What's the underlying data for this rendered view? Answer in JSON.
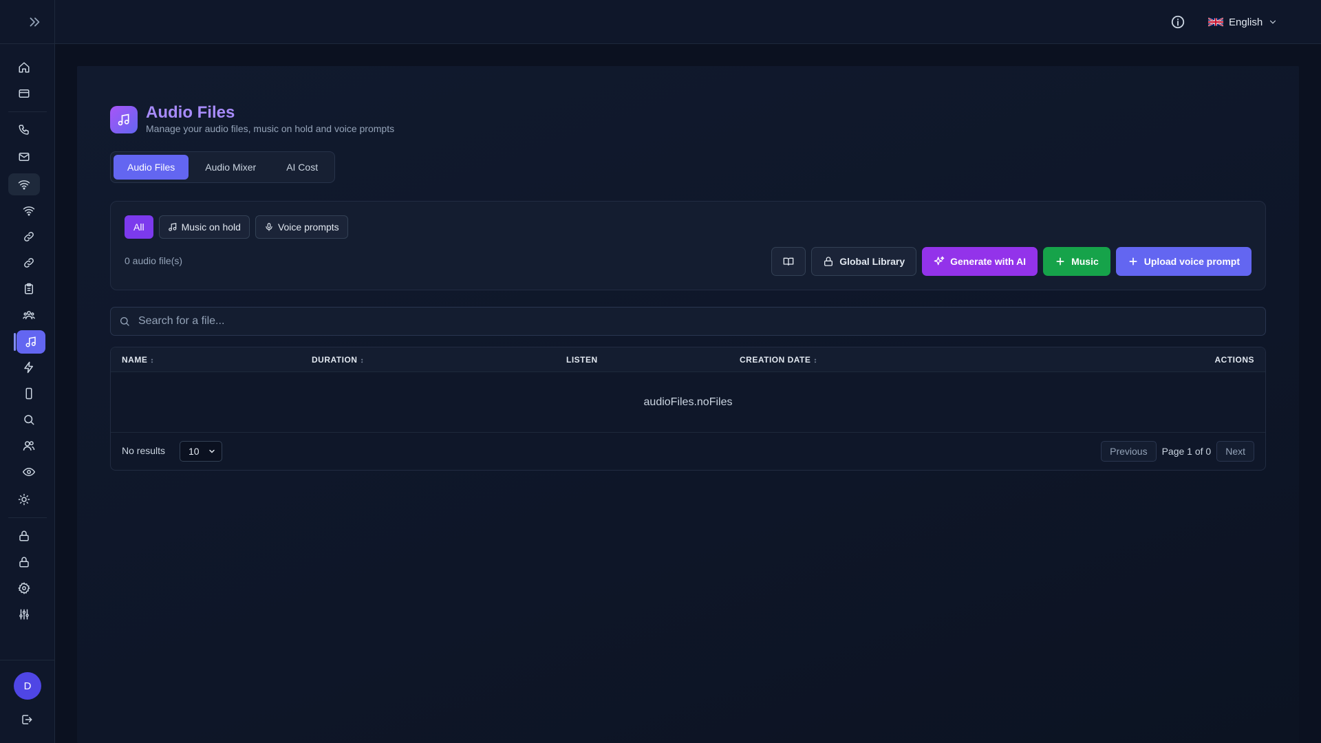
{
  "topbar": {
    "language": "English",
    "info_icon": "info-icon",
    "flag_icon": "uk-flag-icon"
  },
  "sidebar": {
    "expand_icon": "double-chevron-right-icon",
    "items": [
      {
        "icon": "home-icon"
      },
      {
        "icon": "card-icon"
      },
      {
        "icon": "phone-icon"
      },
      {
        "icon": "mail-icon"
      },
      {
        "icon": "wifi-icon"
      },
      {
        "icon": "wifi-icon"
      },
      {
        "icon": "link-icon"
      },
      {
        "icon": "link-icon"
      },
      {
        "icon": "clipboard-icon"
      },
      {
        "icon": "users-group-icon"
      },
      {
        "icon": "music-icon"
      },
      {
        "icon": "lightning-icon"
      },
      {
        "icon": "mobile-icon"
      },
      {
        "icon": "search-icon"
      },
      {
        "icon": "users-icon"
      },
      {
        "icon": "eye-icon"
      },
      {
        "icon": "lightbulb-icon"
      },
      {
        "icon": "lock-icon"
      },
      {
        "icon": "lock-icon"
      },
      {
        "icon": "gear-icon"
      },
      {
        "icon": "sliders-icon"
      }
    ],
    "avatar_initial": "D",
    "logout_icon": "logout-icon"
  },
  "header": {
    "title": "Audio Files",
    "subtitle": "Manage your audio files, music on hold and voice prompts"
  },
  "tabs": [
    {
      "label": "Audio Files",
      "active": true
    },
    {
      "label": "Audio Mixer",
      "active": false
    },
    {
      "label": "AI Cost",
      "active": false
    }
  ],
  "filters": {
    "chips": [
      {
        "label": "All",
        "active": true
      },
      {
        "label": "Music on hold",
        "icon": "music-icon"
      },
      {
        "label": "Voice prompts",
        "icon": "mic-icon"
      }
    ],
    "count_text": "0 audio file(s)"
  },
  "actions": {
    "book_icon": "book-icon",
    "global_library": "Global Library",
    "generate_ai": "Generate with AI",
    "music": "Music",
    "upload_voice": "Upload voice prompt"
  },
  "search": {
    "placeholder": "Search for a file..."
  },
  "table": {
    "columns": [
      {
        "label": "NAME",
        "sortable": true
      },
      {
        "label": "DURATION",
        "sortable": true
      },
      {
        "label": "LISTEN",
        "sortable": false
      },
      {
        "label": "CREATION DATE",
        "sortable": true
      },
      {
        "label": "ACTIONS",
        "sortable": false
      }
    ],
    "empty_text": "audioFiles.noFiles",
    "no_results": "No results",
    "page_size": "10",
    "prev": "Previous",
    "page_info": "Page 1 of 0",
    "next": "Next"
  },
  "colors": {
    "accent": "#6366f1",
    "purple": "#9333ea",
    "green": "#16a34a",
    "background": "#0b1120"
  }
}
